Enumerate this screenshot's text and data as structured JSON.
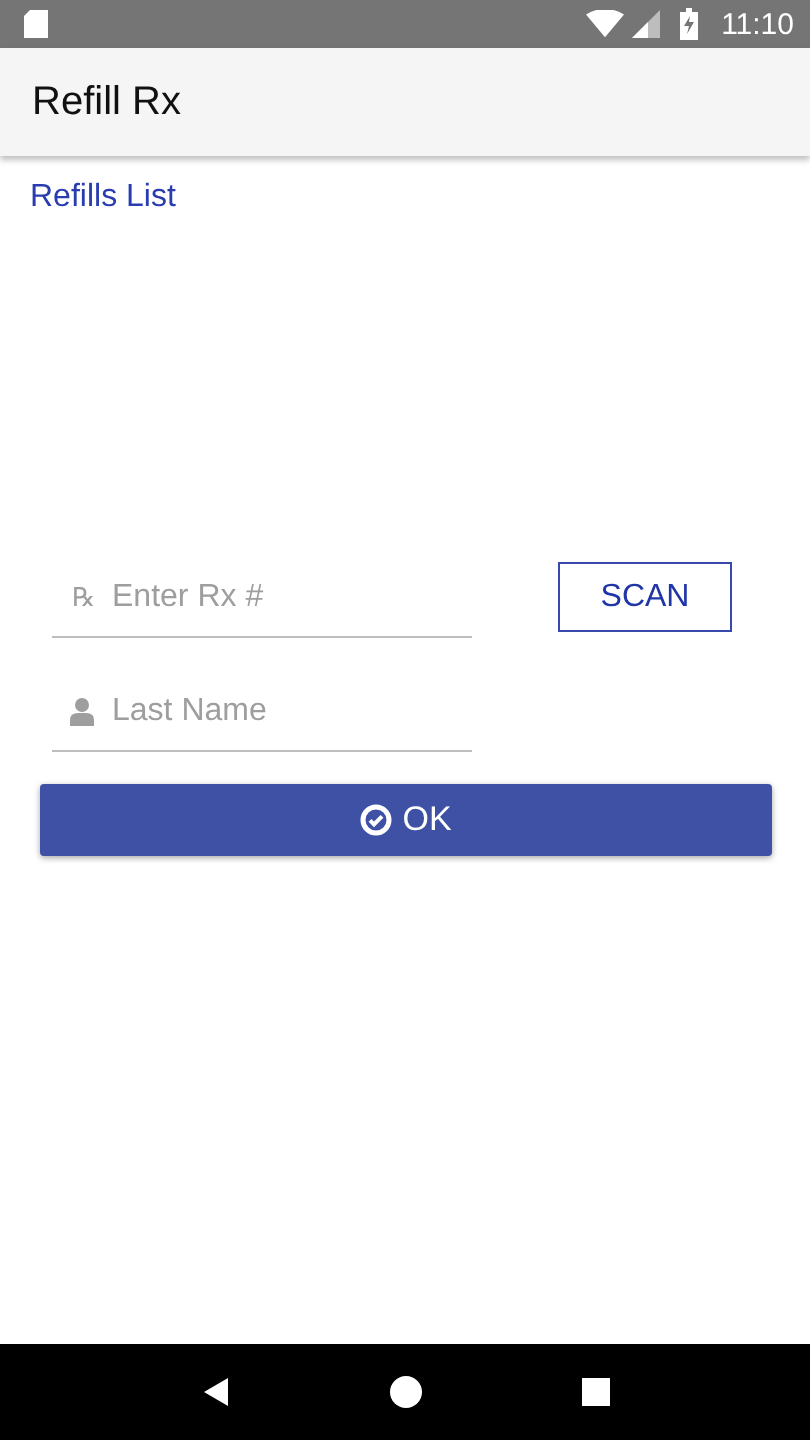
{
  "status_bar": {
    "time": "11:10"
  },
  "app_bar": {
    "title": "Refill Rx"
  },
  "link": "Refills List",
  "rx_field": {
    "icon_glyph": "℞",
    "placeholder": "Enter Rx #"
  },
  "scan_button": "SCAN",
  "name_field": {
    "placeholder": "Last Name"
  },
  "ok_button": "OK"
}
